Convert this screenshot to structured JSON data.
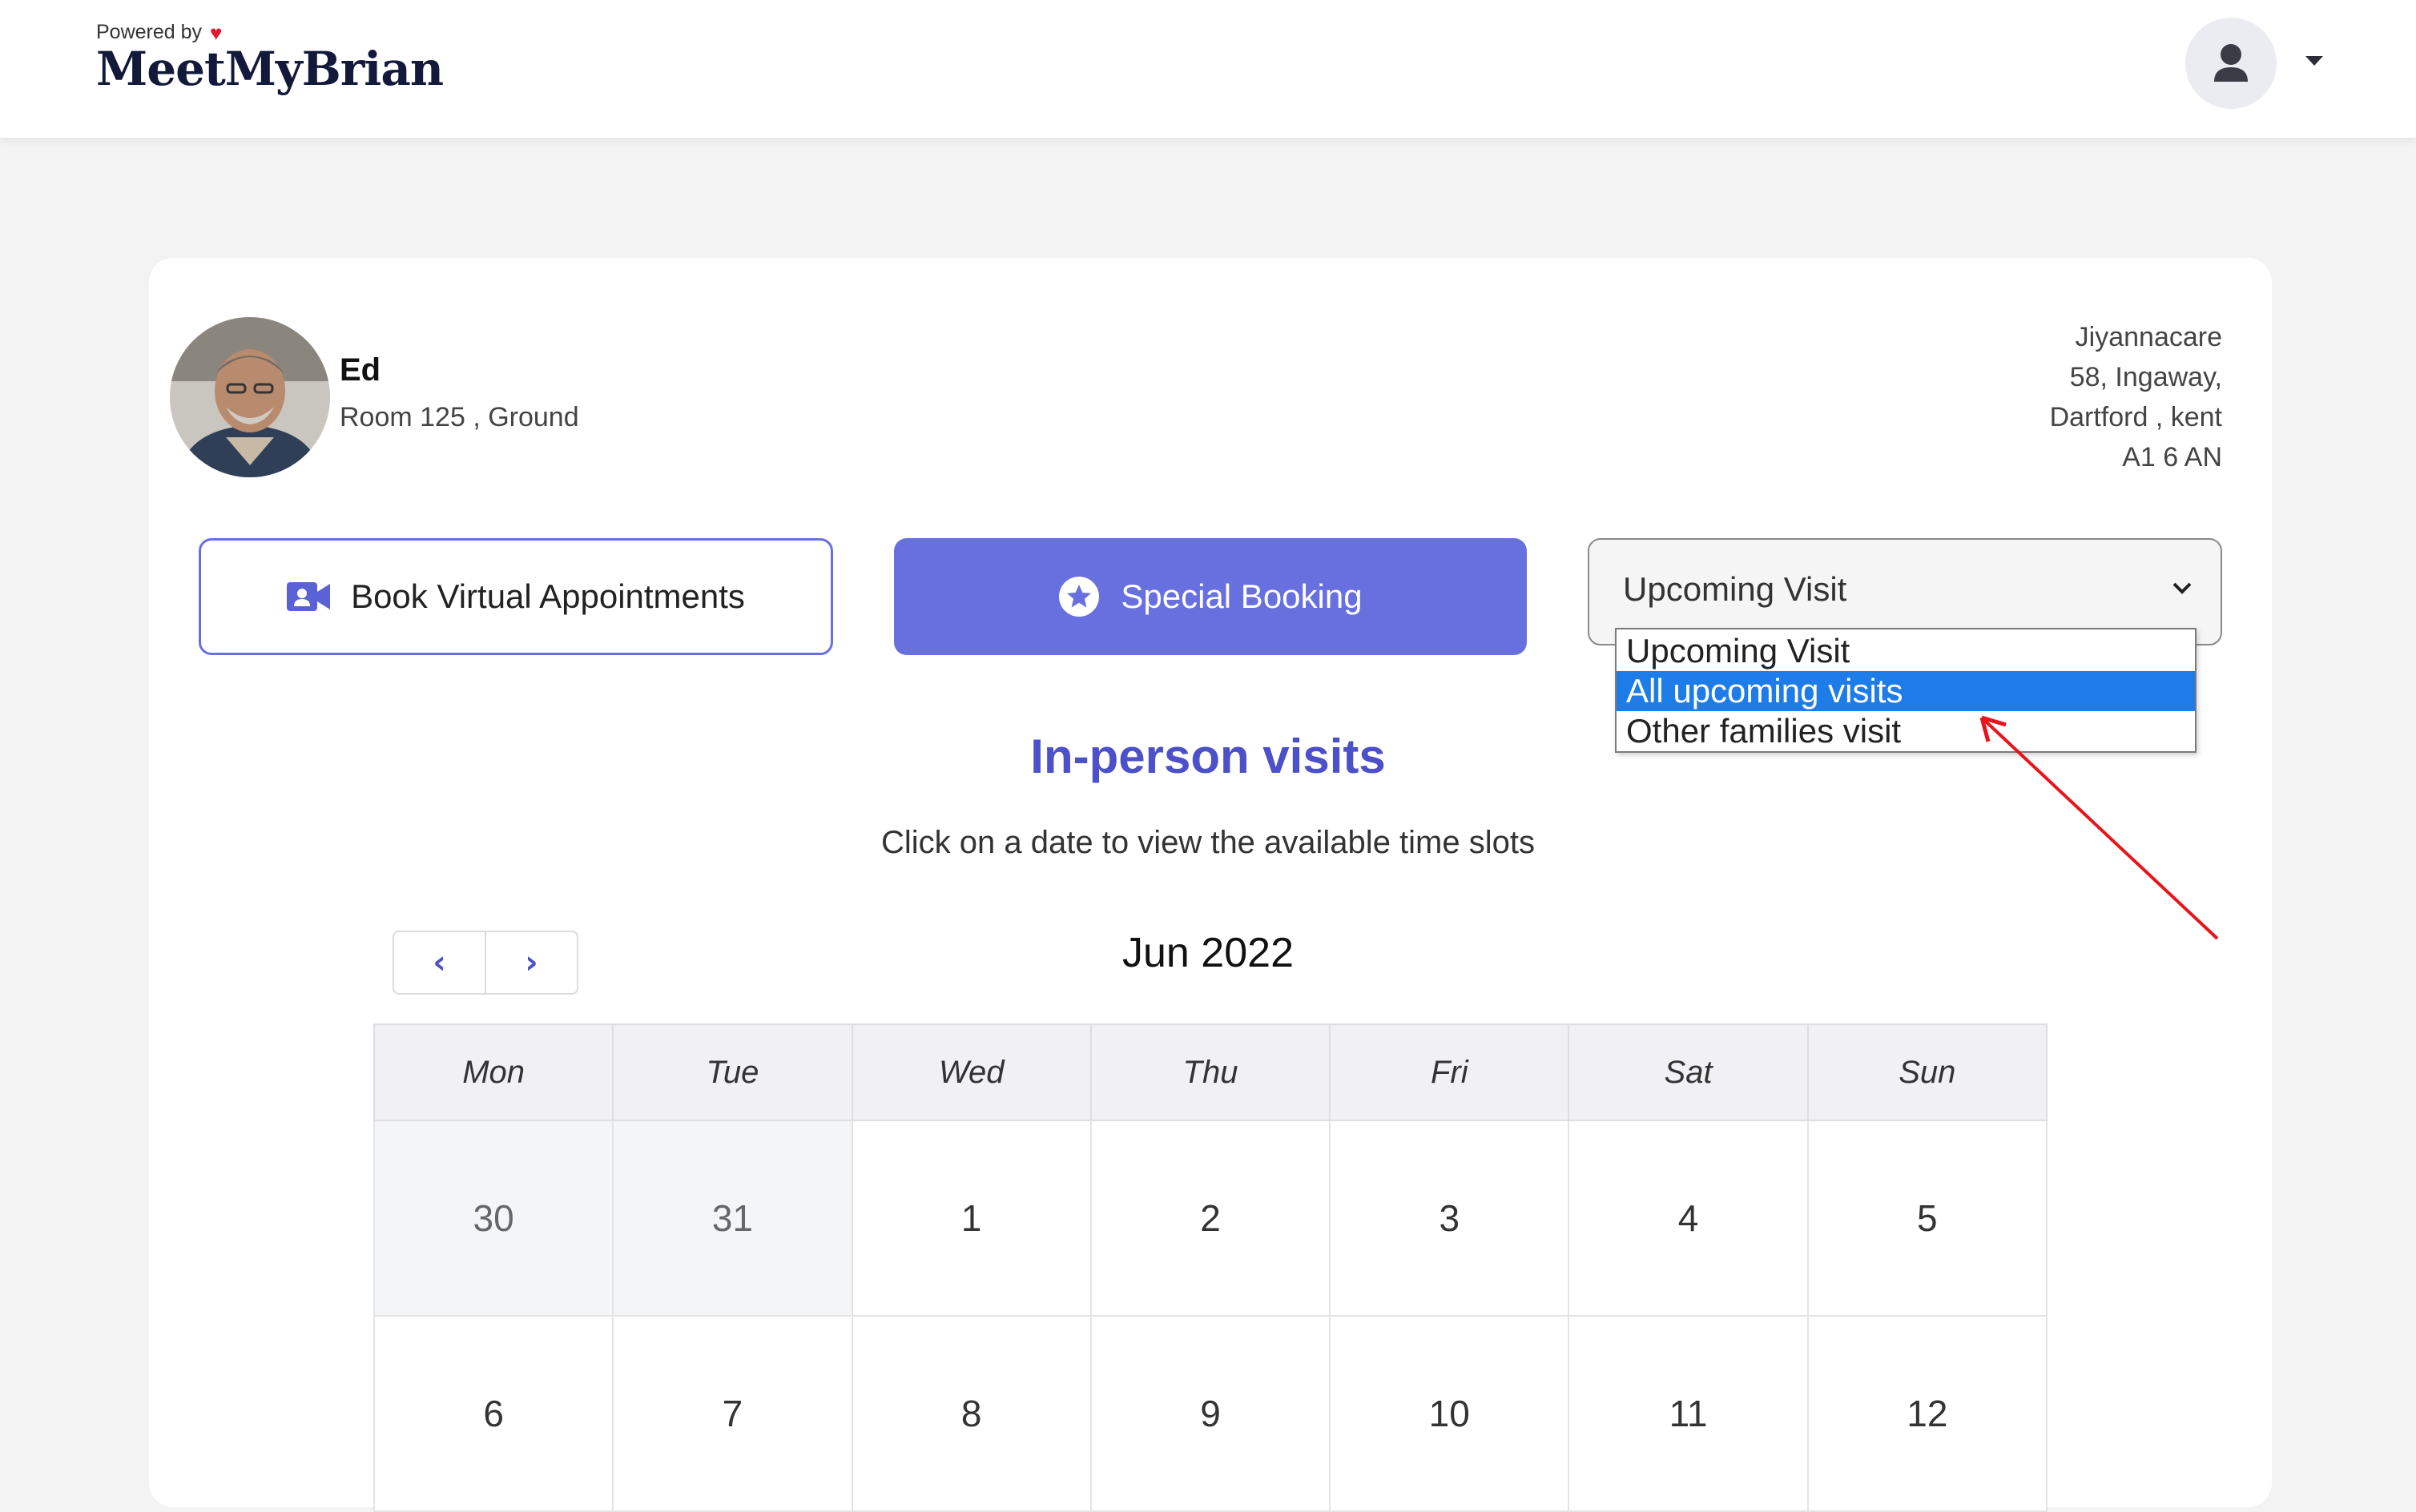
{
  "header": {
    "powered_by": "Powered by",
    "brand": "MeetMyBrian",
    "heart_icon": "heart-icon",
    "user_icon": "user-icon",
    "menu_icon": "caret-down-icon"
  },
  "resident": {
    "name": "Ed",
    "room": "Room 125 , Ground"
  },
  "address": {
    "line1": "Jiyannacare",
    "line2": "58, Ingaway,",
    "line3": "Dartford , kent",
    "line4": "A1 6 AN"
  },
  "actions": {
    "virtual_label": "Book Virtual Appointments",
    "special_label": "Special Booking"
  },
  "visit_select": {
    "value": "Upcoming Visit",
    "options": [
      "Upcoming Visit",
      "All upcoming visits",
      "Other families visit"
    ],
    "highlighted": "All upcoming visits"
  },
  "section": {
    "title": "In-person visits",
    "subtitle": "Click on a date to view the available time slots"
  },
  "calendar": {
    "month": "Jun 2022",
    "weekdays": [
      "Mon",
      "Tue",
      "Wed",
      "Thu",
      "Fri",
      "Sat",
      "Sun"
    ],
    "weeks": [
      [
        "30",
        "31",
        "1",
        "2",
        "3",
        "4",
        "5"
      ],
      [
        "6",
        "7",
        "8",
        "9",
        "10",
        "11",
        "12"
      ]
    ]
  },
  "colors": {
    "accent": "#6770de",
    "title": "#4c50c9",
    "highlight": "#1e7ce8",
    "annotation_arrow": "#e8141c"
  }
}
